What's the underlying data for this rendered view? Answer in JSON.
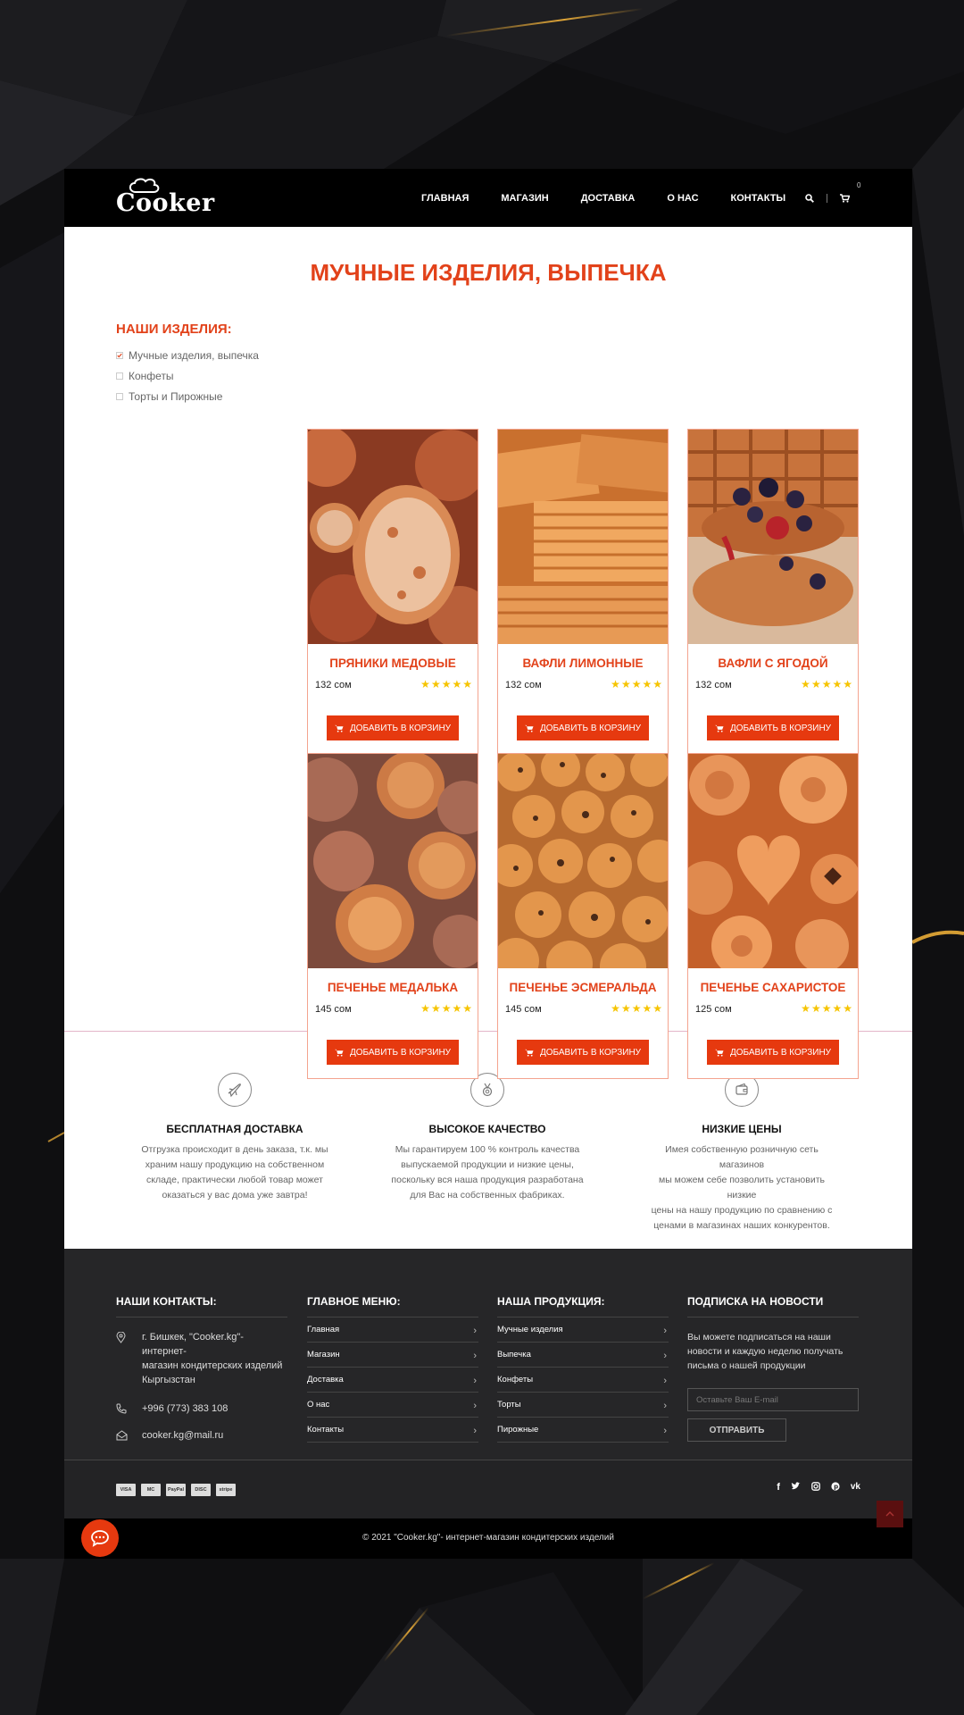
{
  "brand": {
    "logo_text": "Cooker"
  },
  "nav": {
    "items": [
      "ГЛАВНАЯ",
      "МАГАЗИН",
      "ДОСТАВКА",
      "О НАС",
      "КОНТАКТЫ"
    ],
    "cart_count": "0",
    "icons": [
      "search-icon",
      "cart-icon"
    ]
  },
  "page": {
    "title": "МУЧНЫЕ ИЗДЕЛИЯ, ВЫПЕЧКА"
  },
  "sidebar": {
    "title": "НАШИ ИЗДЕЛИЯ:",
    "categories": [
      {
        "label": "Мучные изделия, выпечка",
        "checked": true
      },
      {
        "label": "Конфеты",
        "checked": false
      },
      {
        "label": "Торты и Пирожные",
        "checked": false
      }
    ]
  },
  "products": [
    {
      "name": "ПРЯНИКИ МЕДОВЫЕ",
      "price": "132 сом",
      "rating": 5,
      "button": "ДОБАВИТЬ В КОРЗИНУ",
      "image": "honey-gingerbread"
    },
    {
      "name": "ВАФЛИ ЛИМОННЫЕ",
      "price": "132 сом",
      "rating": 5,
      "button": "ДОБАВИТЬ В КОРЗИНУ",
      "image": "lemon-wafers"
    },
    {
      "name": "ВАФЛИ С ЯГОДОЙ",
      "price": "132 сом",
      "rating": 5,
      "button": "ДОБАВИТЬ В КОРЗИНУ",
      "image": "berry-waffles"
    },
    {
      "name": "ПЕЧЕНЬЕ МЕДАЛЬКА",
      "price": "145 сом",
      "rating": 5,
      "button": "ДОБАВИТЬ В КОРЗИНУ",
      "image": "medal-cookies"
    },
    {
      "name": "ПЕЧЕНЬЕ ЭСМЕРАЛЬДА",
      "price": "145 сом",
      "rating": 5,
      "button": "ДОБАВИТЬ В КОРЗИНУ",
      "image": "chocolate-chip-cookies"
    },
    {
      "name": "ПЕЧЕНЬЕ САХАРИСТОЕ",
      "price": "125 сом",
      "rating": 5,
      "button": "ДОБАВИТЬ В КОРЗИНУ",
      "image": "sugar-cookies"
    }
  ],
  "features": [
    {
      "icon": "airplane-icon",
      "title": "БЕСПЛАТНАЯ ДОСТАВКА",
      "lines": [
        "Отгрузка происходит в день заказа, т.к. мы",
        "храним нашу продукцию на собственном",
        "складе, практически любой товар может",
        "оказаться у вас дома уже завтра!"
      ]
    },
    {
      "icon": "medal-icon",
      "title": "ВЫСОКОЕ КАЧЕСТВО",
      "lines": [
        "Мы гарантируем 100 % контроль качества",
        "выпускаемой продукции и низкие цены,",
        "поскольку вся наша продукция разработана",
        "для Вас на собственных фабриках."
      ]
    },
    {
      "icon": "wallet-icon",
      "title": "НИЗКИЕ ЦЕНЫ",
      "lines": [
        "Имея собственную розничную сеть магазинов",
        "мы можем себе позволить установить низкие",
        "цены на нашу продукцию по сравнению с",
        "ценами в магазинах наших конкурентов."
      ]
    }
  ],
  "footer": {
    "contacts": {
      "title": "НАШИ КОНТАКТЫ:",
      "address_lines": [
        "г. Бишкек, \"Cooker.kg\"- интернет-",
        "магазин кондитерских изделий",
        "Кыргызстан"
      ],
      "phone": "+996 (773) 383 108",
      "email": "cooker.kg@mail.ru"
    },
    "menu": {
      "title": "ГЛАВНОЕ МЕНЮ:",
      "items": [
        "Главная",
        "Магазин",
        "Доставка",
        "О нас",
        "Контакты"
      ]
    },
    "products": {
      "title": "НАША ПРОДУКЦИЯ:",
      "items": [
        "Мучные изделия",
        "Выпечка",
        "Конфеты",
        "Торты",
        "Пирожные"
      ]
    },
    "subscribe": {
      "title": "ПОДПИСКА НА НОВОСТИ",
      "text_lines": [
        "Вы можете подписаться на наши",
        "новости и каждую неделю получать",
        "письма о нашей продукции"
      ],
      "placeholder": "Оставьте Ваш E-mail",
      "button": "ОТПРАВИТЬ"
    },
    "payments": [
      "VISA",
      "MC",
      "PayPal",
      "DISC",
      "stripe"
    ],
    "social_icons": [
      "facebook-icon",
      "twitter-icon",
      "instagram-icon",
      "pinterest-icon",
      "vk-icon"
    ],
    "copyright": "© 2021 \"Cooker.kg\"- интернет-магазин кондитерских изделий"
  },
  "colors": {
    "accent": "#e2421a",
    "button": "#e6390f",
    "header": "#000000",
    "footer": "#262628",
    "star": "#f6c400"
  }
}
